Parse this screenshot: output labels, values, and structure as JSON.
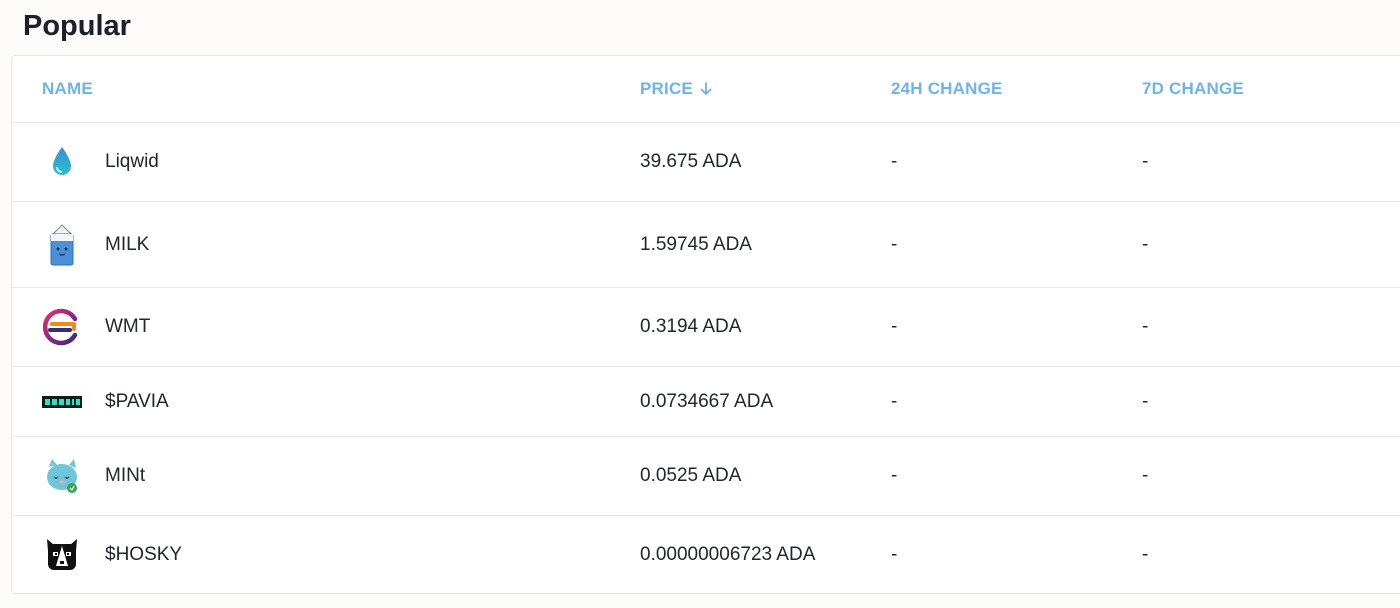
{
  "page": {
    "title": "Popular"
  },
  "table": {
    "headers": {
      "name": "NAME",
      "price": "PRICE",
      "change_24h": "24H CHANGE",
      "change_7d": "7D CHANGE"
    },
    "sort": {
      "column": "price",
      "direction": "descending",
      "icon": "arrow-down-icon"
    },
    "rows": [
      {
        "name": "Liqwid",
        "icon": "liqwid-drop-icon",
        "price": "39.675 ADA",
        "change_24h": "-",
        "change_7d": "-"
      },
      {
        "name": "MILK",
        "icon": "milk-carton-icon",
        "price": "1.59745 ADA",
        "change_24h": "-",
        "change_7d": "-"
      },
      {
        "name": "WMT",
        "icon": "wmt-logo-icon",
        "price": "0.3194 ADA",
        "change_24h": "-",
        "change_7d": "-"
      },
      {
        "name": "$PAVIA",
        "icon": "pavia-logo-icon",
        "price": "0.0734667 ADA",
        "change_24h": "-",
        "change_7d": "-"
      },
      {
        "name": "MINt",
        "icon": "mint-cat-icon",
        "price": "0.0525 ADA",
        "change_24h": "-",
        "change_7d": "-"
      },
      {
        "name": "$HOSKY",
        "icon": "hosky-dog-icon",
        "price": "0.00000006723 ADA",
        "change_24h": "-",
        "change_7d": "-"
      }
    ]
  },
  "colors": {
    "header_text": "#6db3ec",
    "body_text": "#222633",
    "background": "#fdfcfa",
    "card_border": "#e7e8ee"
  }
}
